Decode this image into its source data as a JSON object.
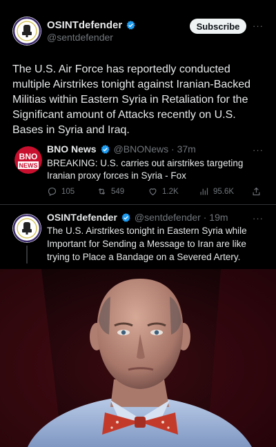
{
  "main_tweet": {
    "author_name": "OSINTdefender",
    "author_handle": "@sentdefender",
    "subscribe_label": "Subscribe",
    "more_label": "···",
    "text": "The U.S. Air Force has reportedly conducted multiple Airstrikes tonight against Iranian-Backed Militias within Eastern Syria in Retaliation for the Significant amount of Attacks recently on U.S. Bases in Syria and Iraq."
  },
  "quoted_tweet": {
    "author_name": "BNO News",
    "author_meta": "@BNONews · 37m",
    "avatar_text_top": "BNO",
    "avatar_text_bottom": "NEWS",
    "more_label": "···",
    "text": "BREAKING: U.S. carries out airstrikes targeting Iranian proxy forces in Syria - Fox",
    "actions": {
      "replies": "105",
      "retweets": "549",
      "likes": "1.2K",
      "views": "95.6K"
    }
  },
  "reply_tweet": {
    "author_name": "OSINTdefender",
    "author_meta": "@sentdefender · 19m",
    "more_label": "···",
    "text": "The U.S. Airstrikes tonight in Eastern Syria while Important for Sending a Message to Iran are like trying to Place a Bandage on a Severed Artery."
  },
  "colors": {
    "background": "#000000",
    "text": "#e7e9ea",
    "muted": "#71767b",
    "verified": "#1d9bf0",
    "bno_red": "#c8102e"
  },
  "icons": [
    "verified-badge-icon",
    "more-icon",
    "reply-icon",
    "retweet-icon",
    "like-icon",
    "views-icon",
    "share-icon"
  ]
}
